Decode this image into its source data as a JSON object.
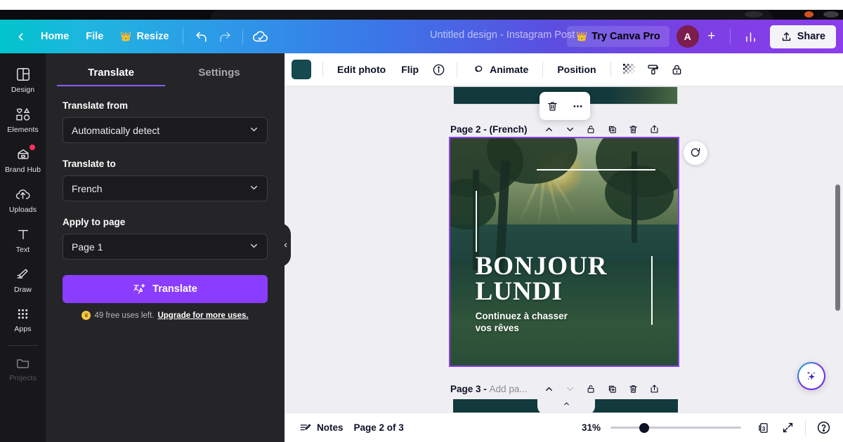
{
  "app": {
    "title": "Untitled design - Instagram Post",
    "accent_purple": "#8b3dff",
    "brand_teal": "#00c4cc"
  },
  "topbar": {
    "back_icon": "chevron-left-icon",
    "home_label": "Home",
    "file_label": "File",
    "resize_label": "Resize",
    "resize_badge": "crown-icon",
    "undo_icon": "undo-icon",
    "redo_icon": "redo-icon",
    "cloud_icon": "cloud-saved-icon",
    "title": "Untitled design - Instagram Post",
    "try_pro_label": "Try Canva Pro",
    "avatar_initial": "A",
    "plus_label": "+",
    "insights_icon": "bar-chart-icon",
    "share_label": "Share"
  },
  "rail": {
    "items": [
      {
        "label": "Design",
        "icon": "design-layout-icon",
        "badge": false
      },
      {
        "label": "Elements",
        "icon": "elements-shapes-icon",
        "badge": false
      },
      {
        "label": "Brand Hub",
        "icon": "brand-hub-icon",
        "badge": true
      },
      {
        "label": "Uploads",
        "icon": "cloud-upload-icon",
        "badge": false
      },
      {
        "label": "Text",
        "icon": "text-t-icon",
        "badge": false
      },
      {
        "label": "Draw",
        "icon": "pen-draw-icon",
        "badge": false
      },
      {
        "label": "Apps",
        "icon": "apps-grid-icon",
        "badge": false
      },
      {
        "label": "Projects",
        "icon": "folder-icon",
        "badge": false
      }
    ]
  },
  "panel": {
    "tabs": [
      {
        "label": "Translate",
        "active": true
      },
      {
        "label": "Settings",
        "active": false
      }
    ],
    "translate_from_label": "Translate from",
    "translate_from_value": "Automatically detect",
    "translate_to_label": "Translate to",
    "translate_to_value": "French",
    "apply_to_page_label": "Apply to page",
    "apply_to_page_value": "Page 1",
    "translate_button_label": "Translate",
    "translate_button_icon": "translate-sparkle-icon",
    "usage_note": "49 free uses left.",
    "usage_link": "Upgrade for more uses.",
    "collapse_icon": "chevron-left-icon"
  },
  "editor_toolbar": {
    "swatch_color": "#154b50",
    "edit_photo_label": "Edit photo",
    "flip_label": "Flip",
    "info_icon": "info-circle-icon",
    "animate_label": "Animate",
    "animate_icon": "animate-circles-icon",
    "position_label": "Position",
    "transparency_icon": "transparency-checker-icon",
    "paint_roller_icon": "paint-roller-icon",
    "lock_icon": "lock-closed-icon"
  },
  "canvas": {
    "pages": [
      {
        "name": "Page 2 -",
        "suffix": "(French)",
        "suffix_muted": false,
        "selected": true,
        "icons": [
          "chevron-up-icon",
          "chevron-down-icon",
          "lock-open-icon",
          "duplicate-page-icon",
          "trash-icon",
          "add-page-icon"
        ]
      },
      {
        "name": "Page 3 -",
        "suffix": "Add pa...",
        "suffix_muted": true,
        "selected": false,
        "icons": [
          "chevron-up-icon",
          "chevron-down-icon",
          "lock-open-icon",
          "duplicate-page-icon",
          "trash-icon",
          "add-page-icon"
        ]
      }
    ],
    "design": {
      "headline_line1": "BONJOUR",
      "headline_line2": "LUNDI",
      "subline_line1": "Continuez à chasser",
      "subline_line2": "vos rêves"
    },
    "context_menu": {
      "trash_icon": "trash-icon",
      "more_icon": "more-horizontal-icon"
    },
    "duplicate_float_icon": "rotate-duplicate-icon",
    "magic_button_icon": "magic-sparkles-icon"
  },
  "bottombar": {
    "notes_label": "Notes",
    "notes_icon": "notes-icon",
    "page_indicator": "Page 2 of 3",
    "zoom_value": "31%",
    "page_count": "3",
    "grid_icon": "page-grid-icon",
    "fullscreen_icon": "expand-icon",
    "help_icon": "help-circle-icon"
  }
}
